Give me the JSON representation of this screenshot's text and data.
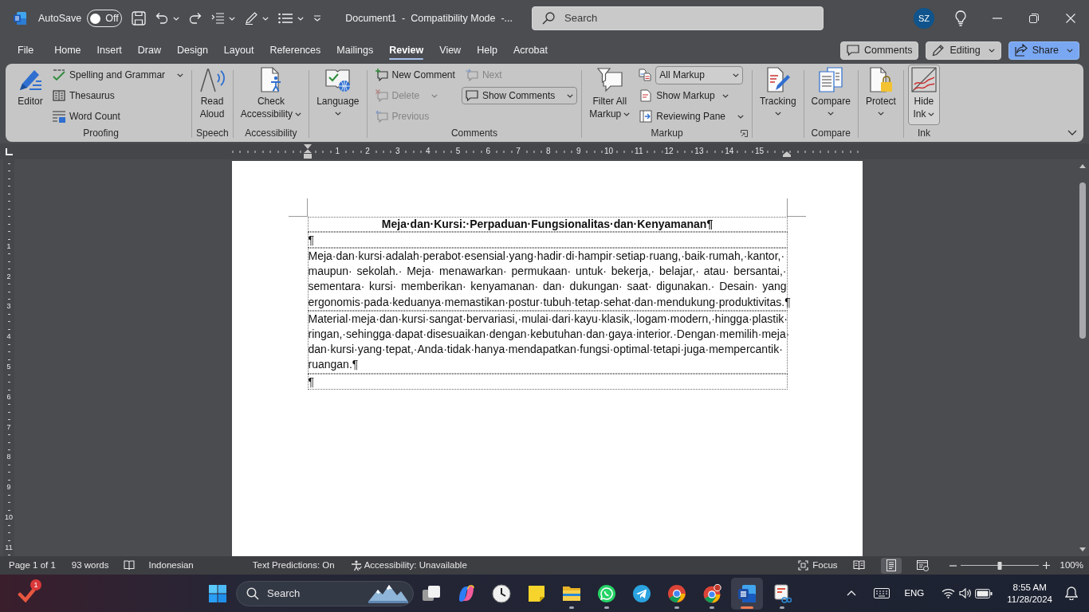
{
  "title_bar": {
    "autosave": {
      "label": "AutoSave",
      "on": false,
      "state_text": "Off"
    },
    "document_title": "Document1  -  Compatibility Mode  -...",
    "search": {
      "placeholder": "Search"
    },
    "account_initials": "SZ"
  },
  "tabs": [
    {
      "label": "File",
      "selected": false
    },
    {
      "label": "Home",
      "selected": false
    },
    {
      "label": "Insert",
      "selected": false
    },
    {
      "label": "Draw",
      "selected": false
    },
    {
      "label": "Design",
      "selected": false
    },
    {
      "label": "Layout",
      "selected": false
    },
    {
      "label": "References",
      "selected": false
    },
    {
      "label": "Mailings",
      "selected": false
    },
    {
      "label": "Review",
      "selected": true
    },
    {
      "label": "View",
      "selected": false
    },
    {
      "label": "Help",
      "selected": false
    },
    {
      "label": "Acrobat",
      "selected": false
    }
  ],
  "header_buttons": [
    {
      "kind": "secondary",
      "label": "Comments"
    },
    {
      "kind": "secondary",
      "label": "Editing",
      "dropdown": true
    },
    {
      "kind": "primary",
      "label": "Share",
      "dropdown": true
    }
  ],
  "ribbon": {
    "groups": [
      {
        "label": "Proofing",
        "items": [
          {
            "kind": "large",
            "label": "Editor",
            "pressed": false
          },
          {
            "kind": "stack",
            "buttons": [
              {
                "kind": "split",
                "label": "Spelling and Grammar",
                "dropdown": true
              },
              {
                "kind": "button",
                "label": "Thesaurus"
              },
              {
                "kind": "button",
                "label": "Word Count"
              }
            ]
          }
        ]
      },
      {
        "label": "Speech",
        "items": [
          {
            "kind": "large",
            "label": "Read\nAloud",
            "pressed": false
          }
        ]
      },
      {
        "label": "Accessibility",
        "items": [
          {
            "kind": "large",
            "label": "Check\nAccessibility",
            "dropdown": true,
            "pressed": false
          }
        ]
      },
      {
        "items": [
          {
            "kind": "menu",
            "label": "Language",
            "dropdown": true,
            "pressed": false
          }
        ]
      },
      {
        "label": "Comments",
        "items": [
          {
            "kind": "stack",
            "buttons": [
              {
                "kind": "button",
                "label": "New Comment",
                "disabled": false,
                "pressed": false
              },
              {
                "kind": "split",
                "label": "Delete",
                "dropdown": true,
                "disabled": true,
                "pressed": false
              },
              {
                "kind": "button",
                "label": "Previous",
                "disabled": true,
                "pressed": false
              }
            ]
          },
          {
            "kind": "stack",
            "buttons": [
              {
                "kind": "button",
                "label": "Next",
                "disabled": true,
                "pressed": false
              },
              {
                "kind": "split",
                "label": "Show Comments",
                "dropdown": true,
                "disabled": false,
                "pressed": true
              }
            ]
          }
        ]
      },
      {
        "label": "Markup",
        "launcher": true,
        "items": [
          {
            "kind": "large",
            "label": "Filter All\nMarkup",
            "dropdown": true,
            "pressed": false
          },
          {
            "kind": "stack",
            "buttons": [
              {
                "kind": "select",
                "value": "All Markup"
              },
              {
                "kind": "button",
                "label": "Show Markup",
                "dropdown": true
              },
              {
                "kind": "split",
                "label": "Reviewing Pane",
                "dropdown": true
              }
            ]
          }
        ]
      },
      {
        "items": [
          {
            "kind": "menu",
            "label": "Tracking",
            "dropdown": true,
            "pressed": false
          }
        ]
      },
      {
        "label": "Compare",
        "items": [
          {
            "kind": "menu",
            "label": "Compare",
            "dropdown": true,
            "pressed": false
          }
        ]
      },
      {
        "items": [
          {
            "kind": "menu",
            "label": "Protect",
            "dropdown": true,
            "pressed": false
          }
        ]
      },
      {
        "label": "Ink",
        "items": [
          {
            "kind": "large",
            "label": "Hide\nInk",
            "dropdown": true,
            "pressed": true
          }
        ]
      }
    ]
  },
  "ruler": {
    "horizontal": [
      "1",
      "2",
      "3",
      "4",
      "5",
      "6",
      "7",
      "8",
      "9",
      "10",
      "11",
      "12",
      "13",
      "14",
      "15"
    ],
    "vertical": [
      "1",
      "2",
      "3",
      "4",
      "5",
      "6",
      "7",
      "8",
      "9",
      "10",
      "11"
    ]
  },
  "document": {
    "rows": [
      {
        "kind": "heading",
        "text": "Meja·dan·Kursi:·Perpaduan·Fungsionalitas·dan·Kenyamanan¶"
      },
      {
        "kind": "mark",
        "text": "¶"
      },
      {
        "kind": "paragraph",
        "lines": [
          "Meja·dan·kursi·adalah·perabot·esensial·yang·hadir·di·hampir·setiap·ruang,·baik·rumah,·kantor,·",
          "maupun· sekolah.· Meja· menawarkan· permukaan· untuk· bekerja,· belajar,· atau· bersantai,·",
          "sementara· kursi· memberikan· kenyamanan· dan· dukungan· saat· digunakan.· Desain· yang",
          "ergonomis·pada·keduanya·memastikan·postur·tubuh·tetap·sehat·dan·mendukung·produktivitas.¶"
        ]
      },
      {
        "kind": "paragraph",
        "lines": [
          "Material·meja·dan·kursi·sangat·bervariasi,·mulai·dari·kayu·klasik,·logam·modern,·hingga·plastik·",
          "ringan,·sehingga·dapat·disesuaikan·dengan·kebutuhan·dan·gaya·interior.·Dengan·memilih·meja·",
          "dan·kursi·yang·tepat,·Anda·tidak·hanya·mendapatkan·fungsi·optimal·tetapi·juga·mempercantik·",
          "ruangan.¶"
        ]
      },
      {
        "kind": "mark",
        "text": "¶"
      }
    ]
  },
  "status_bar": {
    "page": "Page 1 of 1",
    "word_count": "93 words",
    "language": "Indonesian",
    "text_predictions": "Text Predictions: On",
    "accessibility": "Accessibility: Unavailable",
    "focus": "Focus",
    "views": [
      {
        "selected": false
      },
      {
        "selected": true
      },
      {
        "selected": false
      }
    ],
    "zoom": {
      "level": 0.5,
      "percent": "100%"
    }
  },
  "taskbar": {
    "widget_badge": "1",
    "search_label": "Search",
    "apps": [
      {
        "running": false,
        "selected": false
      },
      {
        "running": false,
        "selected": false
      },
      {
        "running": false,
        "selected": false
      },
      {
        "running": false,
        "selected": false
      },
      {
        "running": true,
        "selected": false
      },
      {
        "running": true,
        "selected": false
      },
      {
        "running": false,
        "selected": false
      },
      {
        "running": true,
        "selected": false
      },
      {
        "running": true,
        "selected": false
      },
      {
        "running": true,
        "selected": true
      },
      {
        "running": true,
        "selected": false
      }
    ],
    "language": "ENG",
    "time": "8:55 AM",
    "date": "11/28/2024"
  }
}
